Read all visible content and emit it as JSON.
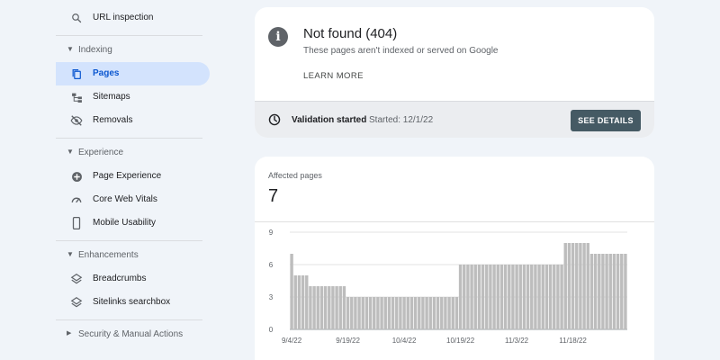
{
  "sidebar": {
    "url_inspection": "URL inspection",
    "indexing_section": "Indexing",
    "pages": "Pages",
    "sitemaps": "Sitemaps",
    "removals": "Removals",
    "experience_section": "Experience",
    "page_experience": "Page Experience",
    "core_web_vitals": "Core Web Vitals",
    "mobile_usability": "Mobile Usability",
    "enhancements_section": "Enhancements",
    "breadcrumbs": "Breadcrumbs",
    "sitelinks_searchbox": "Sitelinks searchbox",
    "security_section": "Security & Manual Actions"
  },
  "issue_card": {
    "title": "Not found (404)",
    "subtitle": "These pages aren't indexed or served on Google",
    "learn_more": "LEARN MORE",
    "validation_label": "Validation started",
    "validation_date": "Started: 12/1/22",
    "see_details": "SEE DETAILS"
  },
  "affected_card": {
    "label": "Affected pages",
    "value": "7"
  },
  "colors": {
    "accent": "#0b57d0",
    "active_bg": "#d3e3fd",
    "bar": "#bdbdbd",
    "button": "#455a64"
  },
  "chart_data": {
    "type": "bar",
    "x_ticks": [
      "9/4/22",
      "9/19/22",
      "10/4/22",
      "10/19/22",
      "11/3/22",
      "11/18/22"
    ],
    "y_ticks": [
      0,
      3,
      6,
      9
    ],
    "ylim": [
      0,
      9
    ],
    "start_date": "2022-09-04",
    "values": [
      7,
      5,
      5,
      5,
      5,
      4,
      4,
      4,
      4,
      4,
      4,
      4,
      4,
      4,
      4,
      3,
      3,
      3,
      3,
      3,
      3,
      3,
      3,
      3,
      3,
      3,
      3,
      3,
      3,
      3,
      3,
      3,
      3,
      3,
      3,
      3,
      3,
      3,
      3,
      3,
      3,
      3,
      3,
      3,
      3,
      6,
      6,
      6,
      6,
      6,
      6,
      6,
      6,
      6,
      6,
      6,
      6,
      6,
      6,
      6,
      6,
      6,
      6,
      6,
      6,
      6,
      6,
      6,
      6,
      6,
      6,
      6,
      6,
      8,
      8,
      8,
      8,
      8,
      8,
      8,
      7,
      7,
      7,
      7,
      7,
      7,
      7,
      7,
      7,
      7
    ]
  }
}
